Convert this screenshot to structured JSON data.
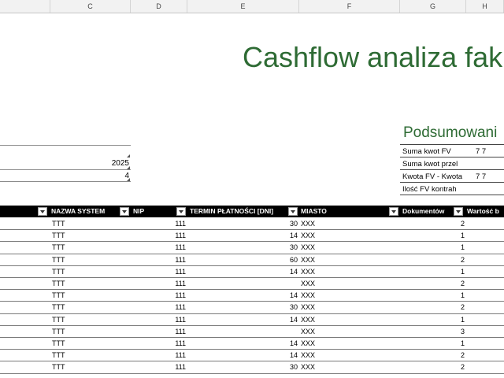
{
  "columns": [
    "C",
    "D",
    "E",
    "F",
    "G",
    "H"
  ],
  "title": "Cashflow analiza fak",
  "params": {
    "year": "2025",
    "month": "4"
  },
  "summary": {
    "heading": "Podsumowani",
    "rows": [
      {
        "label": "Suma kwot FV",
        "value": "7 7"
      },
      {
        "label": "Suma kwot przel",
        "value": ""
      },
      {
        "label": "Kwota FV - Kwota",
        "value": "7 7"
      },
      {
        "label": "Ilość FV kontrah",
        "value": ""
      }
    ]
  },
  "table": {
    "headers": [
      "NAZWA SYSTEM",
      "NIP",
      "TERMIN PŁATNOŚCI [DNI]",
      "MIASTO",
      "Dokumentów",
      "Wartość b"
    ],
    "rows": [
      {
        "system": "TTT",
        "nip": "111",
        "term": "30",
        "city": "XXX",
        "docs": "2"
      },
      {
        "system": "TTT",
        "nip": "111",
        "term": "14",
        "city": "XXX",
        "docs": "1"
      },
      {
        "system": "TTT",
        "nip": "111",
        "term": "30",
        "city": "XXX",
        "docs": "1"
      },
      {
        "system": "TTT",
        "nip": "111",
        "term": "60",
        "city": "XXX",
        "docs": "2"
      },
      {
        "system": "TTT",
        "nip": "111",
        "term": "14",
        "city": "XXX",
        "docs": "1"
      },
      {
        "system": "TTT",
        "nip": "111",
        "term": "",
        "city": "XXX",
        "docs": "2"
      },
      {
        "system": "TTT",
        "nip": "111",
        "term": "14",
        "city": "XXX",
        "docs": "1"
      },
      {
        "system": "TTT",
        "nip": "111",
        "term": "30",
        "city": "XXX",
        "docs": "2"
      },
      {
        "system": "TTT",
        "nip": "111",
        "term": "14",
        "city": "XXX",
        "docs": "1"
      },
      {
        "system": "TTT",
        "nip": "111",
        "term": "",
        "city": "XXX",
        "docs": "3"
      },
      {
        "system": "TTT",
        "nip": "111",
        "term": "14",
        "city": "XXX",
        "docs": "1"
      },
      {
        "system": "TTT",
        "nip": "111",
        "term": "14",
        "city": "XXX",
        "docs": "2"
      },
      {
        "system": "TTT",
        "nip": "111",
        "term": "30",
        "city": "XXX",
        "docs": "2"
      }
    ]
  }
}
